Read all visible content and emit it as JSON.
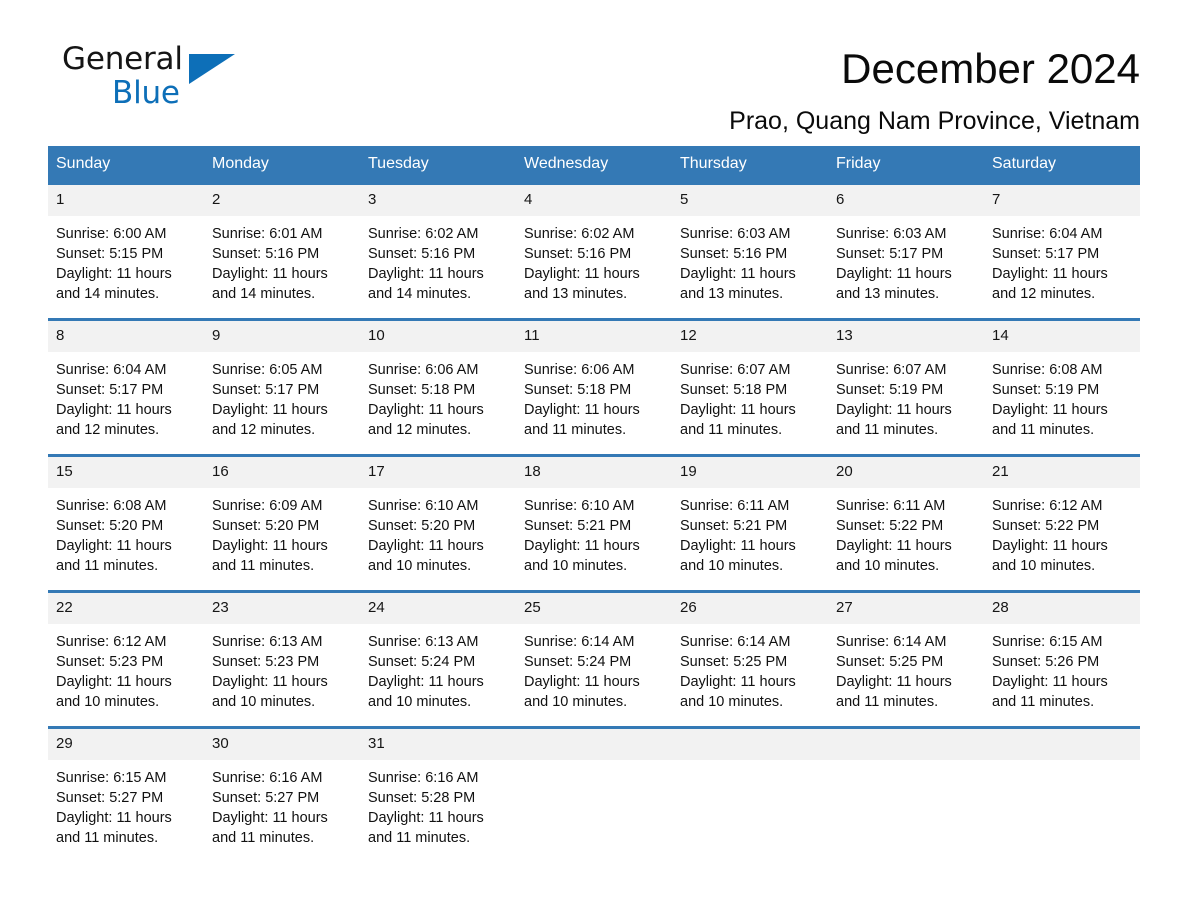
{
  "brand": {
    "name_part1": "General",
    "name_part2": "Blue",
    "flag_icon": "triangle-flag-icon"
  },
  "header": {
    "month_title": "December 2024",
    "location": "Prao, Quang Nam Province, Vietnam"
  },
  "calendar": {
    "weekday_headers": [
      "Sunday",
      "Monday",
      "Tuesday",
      "Wednesday",
      "Thursday",
      "Friday",
      "Saturday"
    ],
    "accent_color": "#3479b5",
    "daynum_band_color": "#f2f2f2",
    "weeks": [
      [
        {
          "day": "1",
          "sunrise": "Sunrise: 6:00 AM",
          "sunset": "Sunset: 5:15 PM",
          "daylight_1": "Daylight: 11 hours",
          "daylight_2": "and 14 minutes."
        },
        {
          "day": "2",
          "sunrise": "Sunrise: 6:01 AM",
          "sunset": "Sunset: 5:16 PM",
          "daylight_1": "Daylight: 11 hours",
          "daylight_2": "and 14 minutes."
        },
        {
          "day": "3",
          "sunrise": "Sunrise: 6:02 AM",
          "sunset": "Sunset: 5:16 PM",
          "daylight_1": "Daylight: 11 hours",
          "daylight_2": "and 14 minutes."
        },
        {
          "day": "4",
          "sunrise": "Sunrise: 6:02 AM",
          "sunset": "Sunset: 5:16 PM",
          "daylight_1": "Daylight: 11 hours",
          "daylight_2": "and 13 minutes."
        },
        {
          "day": "5",
          "sunrise": "Sunrise: 6:03 AM",
          "sunset": "Sunset: 5:16 PM",
          "daylight_1": "Daylight: 11 hours",
          "daylight_2": "and 13 minutes."
        },
        {
          "day": "6",
          "sunrise": "Sunrise: 6:03 AM",
          "sunset": "Sunset: 5:17 PM",
          "daylight_1": "Daylight: 11 hours",
          "daylight_2": "and 13 minutes."
        },
        {
          "day": "7",
          "sunrise": "Sunrise: 6:04 AM",
          "sunset": "Sunset: 5:17 PM",
          "daylight_1": "Daylight: 11 hours",
          "daylight_2": "and 12 minutes."
        }
      ],
      [
        {
          "day": "8",
          "sunrise": "Sunrise: 6:04 AM",
          "sunset": "Sunset: 5:17 PM",
          "daylight_1": "Daylight: 11 hours",
          "daylight_2": "and 12 minutes."
        },
        {
          "day": "9",
          "sunrise": "Sunrise: 6:05 AM",
          "sunset": "Sunset: 5:17 PM",
          "daylight_1": "Daylight: 11 hours",
          "daylight_2": "and 12 minutes."
        },
        {
          "day": "10",
          "sunrise": "Sunrise: 6:06 AM",
          "sunset": "Sunset: 5:18 PM",
          "daylight_1": "Daylight: 11 hours",
          "daylight_2": "and 12 minutes."
        },
        {
          "day": "11",
          "sunrise": "Sunrise: 6:06 AM",
          "sunset": "Sunset: 5:18 PM",
          "daylight_1": "Daylight: 11 hours",
          "daylight_2": "and 11 minutes."
        },
        {
          "day": "12",
          "sunrise": "Sunrise: 6:07 AM",
          "sunset": "Sunset: 5:18 PM",
          "daylight_1": "Daylight: 11 hours",
          "daylight_2": "and 11 minutes."
        },
        {
          "day": "13",
          "sunrise": "Sunrise: 6:07 AM",
          "sunset": "Sunset: 5:19 PM",
          "daylight_1": "Daylight: 11 hours",
          "daylight_2": "and 11 minutes."
        },
        {
          "day": "14",
          "sunrise": "Sunrise: 6:08 AM",
          "sunset": "Sunset: 5:19 PM",
          "daylight_1": "Daylight: 11 hours",
          "daylight_2": "and 11 minutes."
        }
      ],
      [
        {
          "day": "15",
          "sunrise": "Sunrise: 6:08 AM",
          "sunset": "Sunset: 5:20 PM",
          "daylight_1": "Daylight: 11 hours",
          "daylight_2": "and 11 minutes."
        },
        {
          "day": "16",
          "sunrise": "Sunrise: 6:09 AM",
          "sunset": "Sunset: 5:20 PM",
          "daylight_1": "Daylight: 11 hours",
          "daylight_2": "and 11 minutes."
        },
        {
          "day": "17",
          "sunrise": "Sunrise: 6:10 AM",
          "sunset": "Sunset: 5:20 PM",
          "daylight_1": "Daylight: 11 hours",
          "daylight_2": "and 10 minutes."
        },
        {
          "day": "18",
          "sunrise": "Sunrise: 6:10 AM",
          "sunset": "Sunset: 5:21 PM",
          "daylight_1": "Daylight: 11 hours",
          "daylight_2": "and 10 minutes."
        },
        {
          "day": "19",
          "sunrise": "Sunrise: 6:11 AM",
          "sunset": "Sunset: 5:21 PM",
          "daylight_1": "Daylight: 11 hours",
          "daylight_2": "and 10 minutes."
        },
        {
          "day": "20",
          "sunrise": "Sunrise: 6:11 AM",
          "sunset": "Sunset: 5:22 PM",
          "daylight_1": "Daylight: 11 hours",
          "daylight_2": "and 10 minutes."
        },
        {
          "day": "21",
          "sunrise": "Sunrise: 6:12 AM",
          "sunset": "Sunset: 5:22 PM",
          "daylight_1": "Daylight: 11 hours",
          "daylight_2": "and 10 minutes."
        }
      ],
      [
        {
          "day": "22",
          "sunrise": "Sunrise: 6:12 AM",
          "sunset": "Sunset: 5:23 PM",
          "daylight_1": "Daylight: 11 hours",
          "daylight_2": "and 10 minutes."
        },
        {
          "day": "23",
          "sunrise": "Sunrise: 6:13 AM",
          "sunset": "Sunset: 5:23 PM",
          "daylight_1": "Daylight: 11 hours",
          "daylight_2": "and 10 minutes."
        },
        {
          "day": "24",
          "sunrise": "Sunrise: 6:13 AM",
          "sunset": "Sunset: 5:24 PM",
          "daylight_1": "Daylight: 11 hours",
          "daylight_2": "and 10 minutes."
        },
        {
          "day": "25",
          "sunrise": "Sunrise: 6:14 AM",
          "sunset": "Sunset: 5:24 PM",
          "daylight_1": "Daylight: 11 hours",
          "daylight_2": "and 10 minutes."
        },
        {
          "day": "26",
          "sunrise": "Sunrise: 6:14 AM",
          "sunset": "Sunset: 5:25 PM",
          "daylight_1": "Daylight: 11 hours",
          "daylight_2": "and 10 minutes."
        },
        {
          "day": "27",
          "sunrise": "Sunrise: 6:14 AM",
          "sunset": "Sunset: 5:25 PM",
          "daylight_1": "Daylight: 11 hours",
          "daylight_2": "and 11 minutes."
        },
        {
          "day": "28",
          "sunrise": "Sunrise: 6:15 AM",
          "sunset": "Sunset: 5:26 PM",
          "daylight_1": "Daylight: 11 hours",
          "daylight_2": "and 11 minutes."
        }
      ],
      [
        {
          "day": "29",
          "sunrise": "Sunrise: 6:15 AM",
          "sunset": "Sunset: 5:27 PM",
          "daylight_1": "Daylight: 11 hours",
          "daylight_2": "and 11 minutes."
        },
        {
          "day": "30",
          "sunrise": "Sunrise: 6:16 AM",
          "sunset": "Sunset: 5:27 PM",
          "daylight_1": "Daylight: 11 hours",
          "daylight_2": "and 11 minutes."
        },
        {
          "day": "31",
          "sunrise": "Sunrise: 6:16 AM",
          "sunset": "Sunset: 5:28 PM",
          "daylight_1": "Daylight: 11 hours",
          "daylight_2": "and 11 minutes."
        },
        {
          "day": "",
          "sunrise": "",
          "sunset": "",
          "daylight_1": "",
          "daylight_2": ""
        },
        {
          "day": "",
          "sunrise": "",
          "sunset": "",
          "daylight_1": "",
          "daylight_2": ""
        },
        {
          "day": "",
          "sunrise": "",
          "sunset": "",
          "daylight_1": "",
          "daylight_2": ""
        },
        {
          "day": "",
          "sunrise": "",
          "sunset": "",
          "daylight_1": "",
          "daylight_2": ""
        }
      ]
    ]
  }
}
